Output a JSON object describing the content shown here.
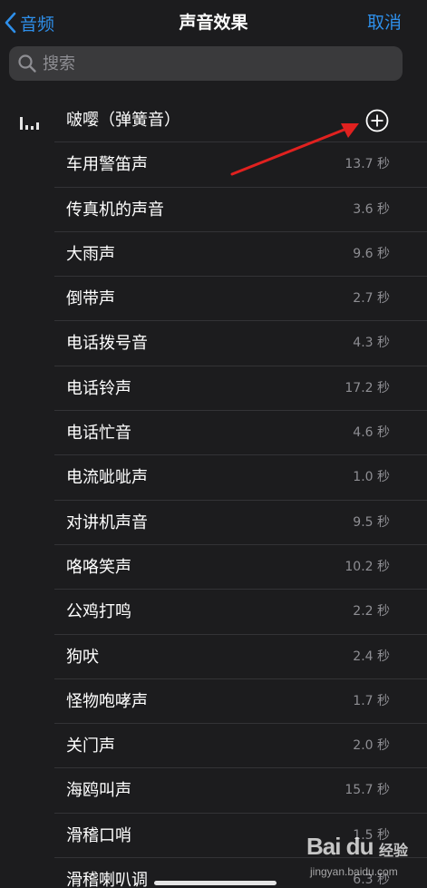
{
  "nav": {
    "back_label": "音频",
    "title": "声音效果",
    "cancel_label": "取消"
  },
  "search": {
    "placeholder": "搜索"
  },
  "sounds": [
    {
      "name": "啵嘤（弹簧音）",
      "duration": ""
    },
    {
      "name": "车用警笛声",
      "duration": "13.7 秒"
    },
    {
      "name": "传真机的声音",
      "duration": "3.6 秒"
    },
    {
      "name": "大雨声",
      "duration": "9.6 秒"
    },
    {
      "name": "倒带声",
      "duration": "2.7 秒"
    },
    {
      "name": "电话拨号音",
      "duration": "4.3 秒"
    },
    {
      "name": "电话铃声",
      "duration": "17.2 秒"
    },
    {
      "name": "电话忙音",
      "duration": "4.6 秒"
    },
    {
      "name": "电流呲呲声",
      "duration": "1.0 秒"
    },
    {
      "name": "对讲机声音",
      "duration": "9.5 秒"
    },
    {
      "name": "咯咯笑声",
      "duration": "10.2 秒"
    },
    {
      "name": "公鸡打鸣",
      "duration": "2.2 秒"
    },
    {
      "name": "狗吠",
      "duration": "2.4 秒"
    },
    {
      "name": "怪物咆哮声",
      "duration": "1.7 秒"
    },
    {
      "name": "关门声",
      "duration": "2.0 秒"
    },
    {
      "name": "海鸥叫声",
      "duration": "15.7 秒"
    },
    {
      "name": "滑稽口哨",
      "duration": "1.5 秒"
    },
    {
      "name": "滑稽喇叭调",
      "duration": "6.3 秒"
    }
  ],
  "watermark": {
    "logo": "Bai du",
    "brand": "经验",
    "url": "jingyan.baidu.com"
  },
  "colors": {
    "accent": "#2e8fea",
    "annotation_arrow": "#e0211f"
  },
  "icons": {
    "back": "chevron-left-icon",
    "search": "magnifier-icon",
    "playing": "waveform-icon",
    "add": "plus-circle-icon"
  }
}
